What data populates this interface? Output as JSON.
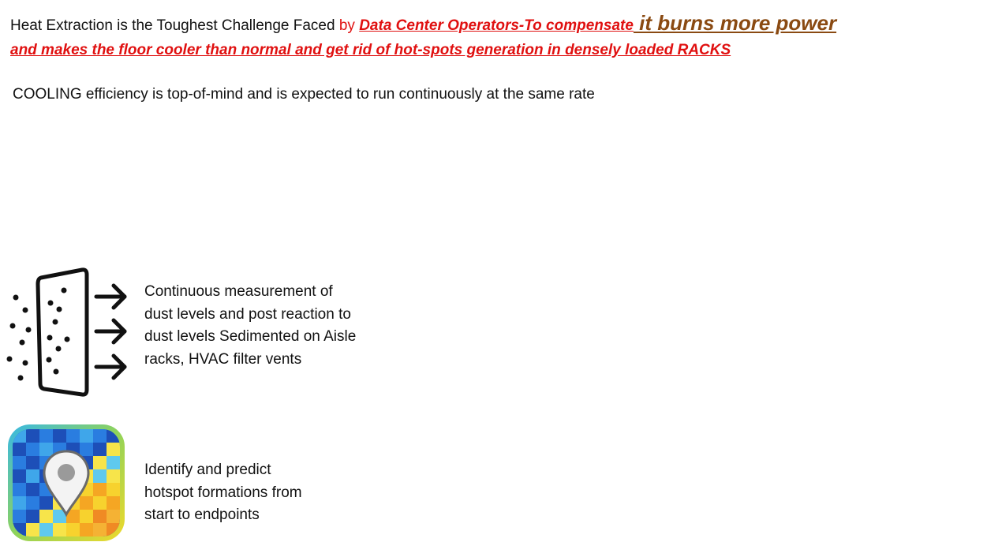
{
  "headline": {
    "part_plain": "Heat Extraction is the Toughest Challenge Faced ",
    "part_by": "by ",
    "part_red_1": "Data Center Operators-To compensate",
    "part_brown": " it burns more power",
    "part_red_2": "and makes the floor cooler than normal and get rid of hot-spots generation in densely loaded RACKS"
  },
  "cooling_statement": "COOLING efficiency is top-of-mind and is expected to run continuously at the same rate",
  "features": [
    {
      "icon": "air-filter-dust-icon",
      "text": "Continuous measurement of\ndust levels and post reaction to\ndust levels Sedimented on Aisle\nracks, HVAC filter vents"
    },
    {
      "icon": "heatmap-location-pin-icon",
      "text": "Identify and predict\nhotspot formations from\nstart to endpoints"
    }
  ],
  "colors": {
    "red_emphasis": "#e01010",
    "brown_emphasis": "#8a4a12",
    "body_text": "#111111"
  }
}
